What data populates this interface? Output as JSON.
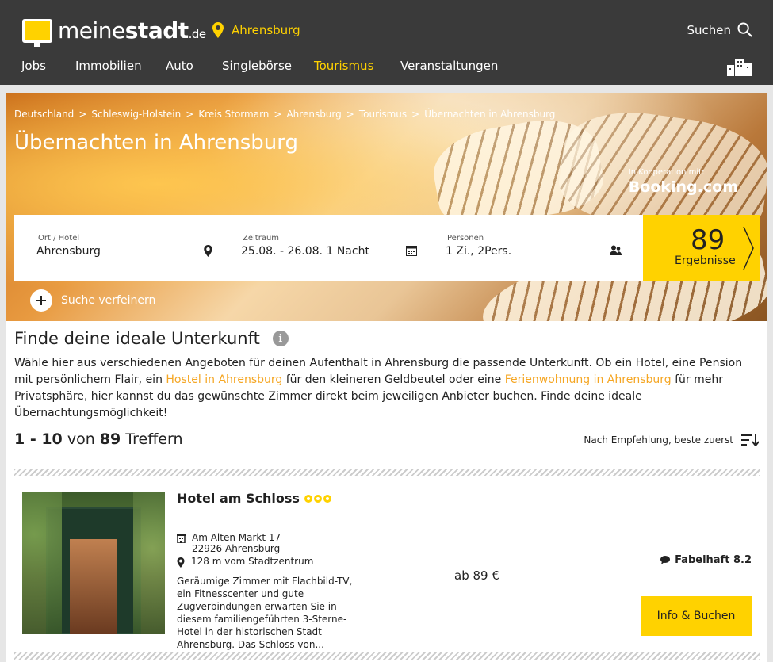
{
  "header": {
    "logo": {
      "prefix": "meine",
      "bold": "stadt",
      "suffix": ".de"
    },
    "location": "Ahrensburg",
    "search_label": "Suchen",
    "nav": [
      {
        "label": "Jobs",
        "active": false
      },
      {
        "label": "Immobilien",
        "active": false
      },
      {
        "label": "Auto",
        "active": false
      },
      {
        "label": "Singlebörse",
        "active": false
      },
      {
        "label": "Tourismus",
        "active": true
      },
      {
        "label": "Veranstaltungen",
        "active": false
      }
    ]
  },
  "hero": {
    "breadcrumb": [
      "Deutschland",
      "Schleswig-Holstein",
      "Kreis Stormarn",
      "Ahrensburg",
      "Tourismus",
      "Übernachten in Ahrensburg"
    ],
    "breadcrumb_separator": ">",
    "title": "Übernachten in Ahrensburg",
    "cooperation_label": "In Kooperation mit:",
    "cooperation_brand": "Booking.com",
    "search": {
      "location": {
        "label": "Ort / Hotel",
        "value": "Ahrensburg"
      },
      "period": {
        "label": "Zeitraum",
        "value": "25.08. - 26.08. 1 Nacht"
      },
      "persons": {
        "label": "Personen",
        "value": "1 Zi., 2Pers."
      }
    },
    "results": {
      "count": "89",
      "label": "Ergebnisse"
    },
    "refine_label": "Suche verfeinern"
  },
  "intro": {
    "title": "Finde deine ideale Unterkunft",
    "info_icon": "i",
    "text_part1": "Wähle hier aus verschiedenen Angeboten für deinen Aufenthalt in Ahrensburg die passende Unterkunft. Ob ein Hotel, eine Pension mit persönlichem Flair, ein ",
    "link1": "Hostel in Ahrensburg",
    "text_part2": " für den kleineren Geldbeutel oder eine ",
    "link2": "Ferienwohnung in Ahrensburg",
    "text_part3": " für mehr Privatsphäre, hier kannst du das gewünschte Zimmer direkt beim jeweiligen Anbieter buchen. Finde deine ideale Übernachtungsmöglichkeit!"
  },
  "listing": {
    "range": "1 - 10",
    "of_label": "von",
    "total": "89",
    "hits_label": "Treffern",
    "sort_label": "Nach Empfehlung, beste zuerst"
  },
  "hotels": [
    {
      "name": "Hotel am Schloss",
      "stars": 3,
      "street": "Am Alten Markt 17",
      "city": "22926 Ahrensburg",
      "distance": "128 m vom Stadtzentrum",
      "description": "Geräumige Zimmer mit Flachbild-TV, ein Fitnesscenter und gute Zugverbindungen erwarten Sie in diesem familiengeführten 3-Sterne-Hotel in der historischen Stadt Ahrensburg. Das Schloss von...",
      "price": "ab 89 €",
      "rating": "Fabelhaft 8.2",
      "button_label": "Info & Buchen"
    }
  ],
  "colors": {
    "accent": "#ffd200",
    "header_bg": "#3a3a3a",
    "link": "#f5a623"
  }
}
